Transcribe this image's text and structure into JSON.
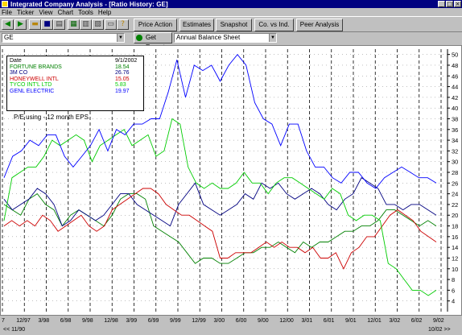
{
  "window": {
    "title": "Integrated Company Analysis - [Ratio History:  GE]",
    "controls": [
      "_",
      "□",
      "×"
    ]
  },
  "menu": {
    "items": [
      {
        "label": "File"
      },
      {
        "label": "Ticker"
      },
      {
        "label": "View"
      },
      {
        "label": "Chart"
      },
      {
        "label": "Tools"
      },
      {
        "label": "Help"
      }
    ]
  },
  "toolbar": {
    "buttons": [
      "Price Action",
      "Estimates",
      "Snapshot",
      "Co. vs Ind.",
      "Peer Analysis"
    ]
  },
  "selectors": {
    "ticker": "GE",
    "report_button": "Get Report",
    "report_type": "Annual Balance Sheet"
  },
  "chart_data": {
    "type": "line",
    "title": "P/E using  - 12 month EPS",
    "legend_header": {
      "label": "Date",
      "value": "9/1/2002"
    },
    "ylim": [
      2,
      51
    ],
    "y_ticks": [
      4,
      6,
      8,
      10,
      12,
      14,
      16,
      18,
      20,
      22,
      24,
      26,
      28,
      30,
      32,
      34,
      36,
      38,
      40,
      42,
      44,
      46,
      48,
      50
    ],
    "x_ticks": [
      "7",
      "12/97",
      "3/98",
      "6/98",
      "9/98",
      "12/98",
      "3/99",
      "6/99",
      "9/99",
      "12/99",
      "3/00",
      "6/00",
      "9/00",
      "12/00",
      "3/01",
      "6/01",
      "9/01",
      "12/01",
      "3/02",
      "6/02",
      "9/02"
    ],
    "nav_left": "<< 11/90",
    "nav_right": "10/02 >>",
    "grid": true,
    "series": [
      {
        "name": "FORTUNE BRANDS",
        "legend_value": "18.54",
        "color": "#008000",
        "values": [
          22,
          21,
          20,
          23,
          24,
          22,
          21,
          18,
          20,
          21,
          20,
          19,
          18,
          20,
          23,
          24,
          24,
          23,
          18,
          17,
          16,
          15,
          13,
          11,
          12,
          12,
          11,
          11,
          12,
          13,
          13,
          14,
          14,
          15,
          14,
          13,
          15,
          14,
          15,
          15,
          16,
          17,
          17,
          18,
          18,
          19,
          21,
          21,
          20,
          19,
          18,
          19,
          18
        ]
      },
      {
        "name": "3M CO",
        "legend_value": "26.76",
        "color": "#000080",
        "values": [
          23,
          21,
          22,
          23,
          25,
          24,
          22,
          18,
          19,
          21,
          20,
          19,
          20,
          22,
          24,
          24,
          22,
          21,
          20,
          19,
          18,
          22,
          24,
          26,
          22,
          21,
          20,
          21,
          22,
          24,
          23,
          26,
          25,
          26,
          24,
          23,
          24,
          25,
          24,
          22,
          21,
          23,
          24,
          27,
          26,
          25,
          22,
          22,
          21,
          22,
          22,
          21,
          20
        ]
      },
      {
        "name": "HONEYWELL INTL",
        "legend_value": "15.05",
        "color": "#cc0000",
        "values": [
          18,
          19,
          18,
          19,
          18,
          20,
          19,
          17,
          18,
          19,
          20,
          18,
          17,
          18,
          21,
          22,
          23,
          24,
          25,
          25,
          24,
          22,
          21,
          20,
          20,
          19,
          18,
          17,
          12,
          12,
          13,
          13,
          13,
          14,
          15,
          14,
          15,
          14,
          14,
          13,
          14,
          12,
          12,
          13,
          10,
          13,
          14,
          16,
          16,
          18,
          20,
          21,
          20,
          19,
          17,
          16,
          15
        ]
      },
      {
        "name": "TYCO INT'L LTD",
        "legend_value": "5.83",
        "color": "#00cc00",
        "values": [
          19,
          27,
          28,
          29,
          29,
          31,
          34,
          33,
          34,
          35,
          34,
          30,
          33,
          34,
          35,
          36,
          33,
          34,
          35,
          31,
          32,
          38,
          37,
          29,
          26,
          25,
          26,
          25,
          25,
          26,
          28,
          26,
          26,
          24,
          26,
          27,
          27,
          26,
          25,
          24,
          23,
          25,
          24,
          20,
          19,
          20,
          20,
          19,
          11,
          10,
          8,
          6,
          6,
          5,
          6
        ]
      },
      {
        "name": "GENL ELECTRIC",
        "legend_value": "19.97",
        "color": "#0000ff",
        "values": [
          27,
          31,
          32,
          34,
          33,
          35,
          35,
          31,
          29,
          31,
          33,
          36,
          32,
          36,
          35,
          37,
          37,
          38,
          38,
          43,
          49,
          42,
          48,
          47,
          48,
          45,
          48,
          50,
          48,
          41,
          38,
          37,
          33,
          37,
          37,
          32,
          29,
          29,
          27,
          26,
          28,
          28,
          26,
          25,
          27,
          28,
          29,
          28,
          27,
          27,
          26
        ]
      }
    ]
  }
}
